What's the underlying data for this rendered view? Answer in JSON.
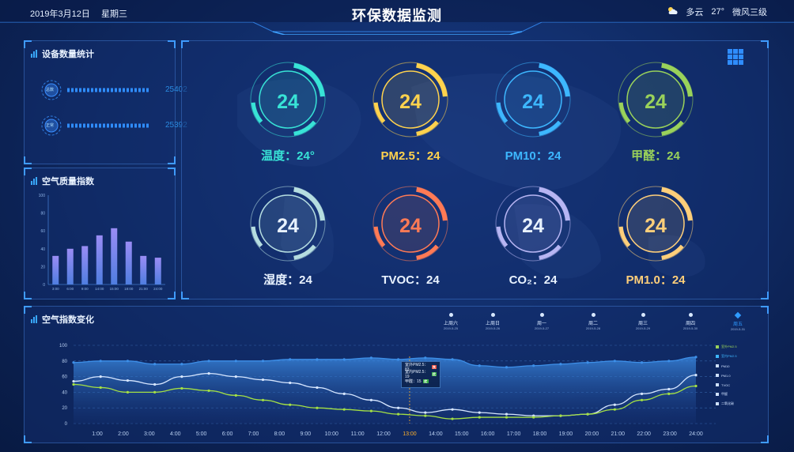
{
  "header": {
    "title": "环保数据监测",
    "date": "2019年3月12日",
    "week": "星期三",
    "weather_icon": "partly-cloudy-icon",
    "weather": "多云",
    "temperature": "27°",
    "wind": "微风三级"
  },
  "device_panel": {
    "title": "设备数量统计",
    "rows": [
      {
        "icon_label": "总数",
        "value": "25402"
      },
      {
        "icon_label": "正常",
        "value": "25392"
      }
    ]
  },
  "air_quality_panel": {
    "title": "空气质量指数"
  },
  "gauges": [
    {
      "value": "24",
      "label": "温度：24°",
      "color": "#38e3d6"
    },
    {
      "value": "24",
      "label": "PM2.5：24",
      "color": "#ffd24d"
    },
    {
      "value": "24",
      "label": "PM10：24",
      "color": "#3db7ff"
    },
    {
      "value": "24",
      "label": "甲醛：24",
      "color": "#9ad25a"
    },
    {
      "value": "24",
      "label": "湿度：24",
      "color": "#b5dde0"
    },
    {
      "value": "24",
      "label": "TVOC：24",
      "color": "#ff7a55"
    },
    {
      "value": "24",
      "label": "CO₂：24",
      "color": "#b7b5f3"
    },
    {
      "value": "24",
      "label": "PM1.0：24",
      "color": "#ffcf7a"
    }
  ],
  "trend_panel": {
    "title": "空气指数变化",
    "timeline": [
      {
        "day": "上周六",
        "date": "2019-5-25"
      },
      {
        "day": "上周日",
        "date": "2019-5-26"
      },
      {
        "day": "周一",
        "date": "2019-5-27"
      },
      {
        "day": "周二",
        "date": "2019-5-28"
      },
      {
        "day": "周三",
        "date": "2019-5-29"
      },
      {
        "day": "周四",
        "date": "2019-5-30"
      },
      {
        "day": "周五",
        "date": "2019-5-31"
      }
    ],
    "tooltip": [
      {
        "label": "室外PM2.5：83",
        "badge": "良",
        "color": "#e84a3a"
      },
      {
        "label": "室内PM2.5：19",
        "badge": "优",
        "color": "#3bb04a"
      },
      {
        "label": "甲醛：15",
        "badge": "优",
        "color": "#3bb04a"
      }
    ],
    "legend": [
      {
        "name": "室外PM2.5",
        "color": "#9ad25a"
      },
      {
        "name": "室内PM2.5",
        "color": "#3db7ff"
      },
      {
        "name": "PM10",
        "color": "#cfe1ff"
      },
      {
        "name": "PM1.0",
        "color": "#cfe1ff"
      },
      {
        "name": "TVOC",
        "color": "#cfe1ff"
      },
      {
        "name": "甲醛",
        "color": "#cfe1ff"
      },
      {
        "name": "二氧化碳",
        "color": "#cfe1ff"
      }
    ]
  },
  "chart_data": [
    {
      "type": "bar",
      "title": "空气质量指数",
      "categories": [
        "3:00",
        "6:00",
        "9:00",
        "14:00",
        "15:00",
        "18:00",
        "21:00",
        "24:00"
      ],
      "values": [
        32,
        40,
        43,
        55,
        63,
        48,
        32,
        30
      ],
      "ylim": [
        0,
        100
      ],
      "yticks": [
        0,
        20,
        40,
        60,
        80,
        100
      ],
      "color": "#7a79e6"
    },
    {
      "type": "line",
      "title": "空气指数变化",
      "categories": [
        "1:00",
        "2:00",
        "3:00",
        "4:00",
        "5:00",
        "6:00",
        "7:00",
        "8:00",
        "9:00",
        "10:00",
        "11:00",
        "12:00",
        "13:00",
        "14:00",
        "15:00",
        "16:00",
        "17:00",
        "18:00",
        "19:00",
        "20:00",
        "21:00",
        "22:00",
        "23:00",
        "24:00"
      ],
      "highlight_category": "13:00",
      "ylim": [
        0,
        100
      ],
      "yticks": [
        0,
        20,
        40,
        60,
        80,
        100
      ],
      "series": [
        {
          "name": "室内PM2.5",
          "color": "#3d8fe8",
          "values": [
            78,
            80,
            80,
            76,
            76,
            80,
            80,
            80,
            82,
            82,
            82,
            84,
            82,
            84,
            82,
            74,
            72,
            74,
            76,
            78,
            80,
            78,
            80,
            85
          ]
        },
        {
          "name": "PM10",
          "color": "#d6e6ff",
          "values": [
            54,
            60,
            55,
            50,
            60,
            64,
            60,
            56,
            52,
            46,
            38,
            30,
            20,
            14,
            18,
            14,
            12,
            10,
            10,
            12,
            24,
            38,
            44,
            62
          ]
        },
        {
          "name": "室外PM2.5",
          "color": "#a4e044",
          "values": [
            50,
            46,
            40,
            40,
            45,
            42,
            36,
            30,
            24,
            20,
            18,
            16,
            12,
            10,
            6,
            8,
            8,
            8,
            10,
            12,
            18,
            30,
            38,
            48
          ]
        }
      ]
    }
  ]
}
